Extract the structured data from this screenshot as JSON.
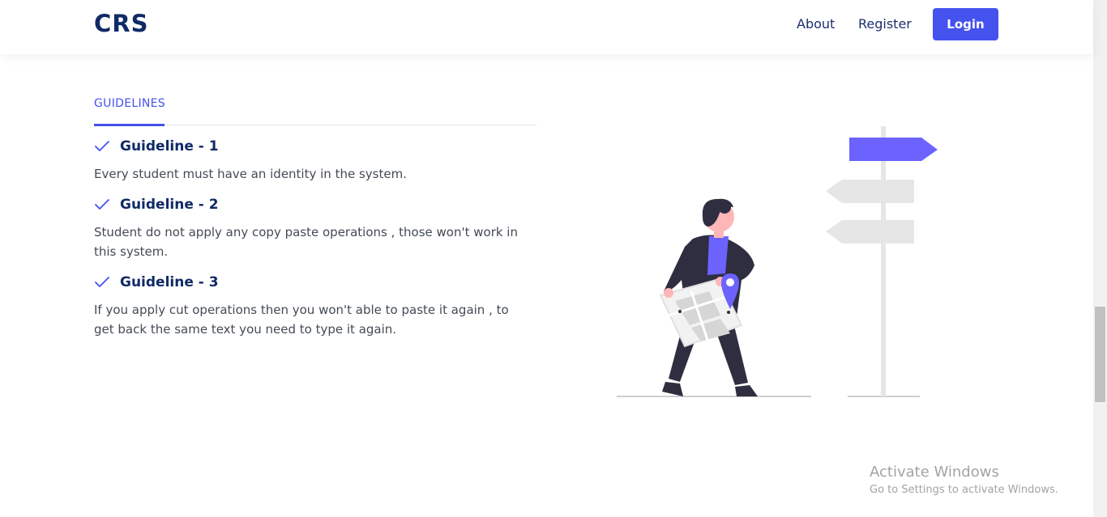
{
  "header": {
    "brand": "CRS",
    "nav": {
      "about": "About",
      "register": "Register",
      "login": "Login"
    }
  },
  "guidelines": {
    "tab_label": "GUIDELINES",
    "items": [
      {
        "title": "Guideline - 1",
        "text": "Every student must have an identity in the system."
      },
      {
        "title": "Guideline - 2",
        "text": "Student do not apply any copy paste operations , those won't work in this system."
      },
      {
        "title": "Guideline - 3",
        "text": "If you apply cut operations then you won't able to paste it again , to get back the same text you need to type it again."
      }
    ],
    "check_icon": "checkmark-icon"
  },
  "illustration": {
    "name": "person-with-map-at-signpost",
    "colors": {
      "accent": "#6c63ff",
      "dark": "#2f2e41",
      "skin": "#ffb6b6",
      "sign": "#e6e6e6"
    }
  },
  "watermark": {
    "title": "Activate Windows",
    "subtitle": "Go to Settings to activate Windows."
  },
  "colors": {
    "brand": "#102a66",
    "primary": "#4452ee",
    "text": "#444b55"
  }
}
